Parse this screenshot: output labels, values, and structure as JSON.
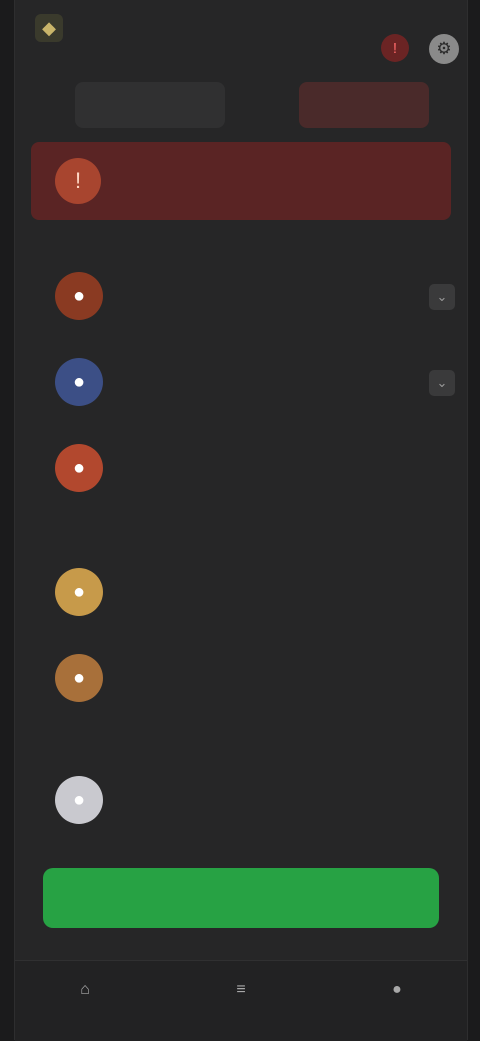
{
  "app": {
    "title": "",
    "logo_icon": "app-logo-icon"
  },
  "header": {
    "alert_icon": "alert-icon",
    "settings_icon": "gear-icon"
  },
  "tabs": [
    {
      "label": ""
    },
    {
      "label": ""
    }
  ],
  "banner": {
    "title": "",
    "subtitle": "",
    "icon": "warning-icon",
    "color": "#5a2424"
  },
  "sections": [
    {
      "label": "",
      "items": [
        {
          "name": "",
          "meta": "",
          "avatar_color": "#8a3a22",
          "has_action": true
        },
        {
          "name": "",
          "meta": "",
          "avatar_color": "#3c4f86",
          "has_action": true
        },
        {
          "name": "",
          "meta": "",
          "avatar_color": "#b2482e",
          "has_action": false
        }
      ]
    },
    {
      "label": "",
      "items": [
        {
          "name": "",
          "meta": "",
          "avatar_color": "#c79a4a",
          "has_action": false
        },
        {
          "name": "",
          "meta": "",
          "avatar_color": "#a8703a",
          "has_action": false
        }
      ]
    },
    {
      "label": "",
      "items": [
        {
          "name": "",
          "meta": "",
          "avatar_color": "#c9c9cf",
          "has_action": false
        }
      ]
    }
  ],
  "cta": {
    "label": "",
    "note": "",
    "color": "#27a244"
  },
  "bottom_nav": [
    {
      "label": "",
      "icon": "home-icon"
    },
    {
      "label": "",
      "icon": "list-icon"
    },
    {
      "label": "",
      "icon": "profile-icon"
    }
  ]
}
